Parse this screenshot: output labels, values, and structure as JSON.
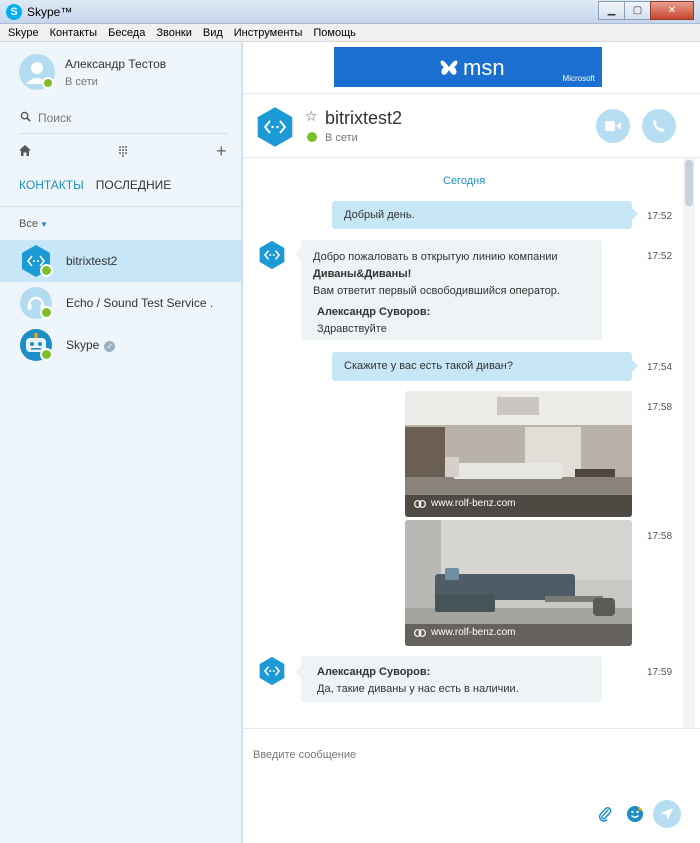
{
  "window": {
    "title": "Skype™"
  },
  "menu": [
    "Skype",
    "Контакты",
    "Беседа",
    "Звонки",
    "Вид",
    "Инструменты",
    "Помощь"
  ],
  "profile": {
    "name": "Александр Тестов",
    "status": "В сети"
  },
  "search": {
    "placeholder": "Поиск"
  },
  "tabs": {
    "contacts": "КОНТАКТЫ",
    "recent": "ПОСЛЕДНИЕ"
  },
  "filter": {
    "label": "Все"
  },
  "contacts": [
    {
      "name": "bitrixtest2",
      "selected": true
    },
    {
      "name": "Echo / Sound Test Service ."
    },
    {
      "name": "Skype"
    }
  ],
  "ad": {
    "brand": "msn",
    "sponsor": "Microsoft"
  },
  "chat": {
    "title": "bitrixtest2",
    "status": "В сети",
    "day": "Сегодня",
    "messages": [
      {
        "text": "Добрый день.",
        "time": "17:52"
      },
      {
        "line1": "Добро пожаловать в открытую линию компании",
        "line2": "Диваны&Диваны!",
        "line3": "Вам ответит первый освободившийся оператор.",
        "sender": "Александр Суворов:",
        "reply": "Здравствуйте",
        "time": "17:52"
      },
      {
        "text": "Скажите у вас есть такой диван?",
        "time": "17:54"
      },
      {
        "caption": "www.rolf-benz.com",
        "time": "17:58"
      },
      {
        "caption": "www.rolf-benz.com",
        "time": "17:58"
      },
      {
        "sender": "Александр Суворов:",
        "text": "Да, такие диваны у нас есть в наличии.",
        "time": "17:59"
      }
    ]
  },
  "compose": {
    "placeholder": "Введите сообщение"
  },
  "colors": {
    "accent": "#1f8ec7",
    "online": "#7dbe2a",
    "selected_row": "#c7e6f7",
    "outgoing_bubble": "#c7e7f7"
  }
}
